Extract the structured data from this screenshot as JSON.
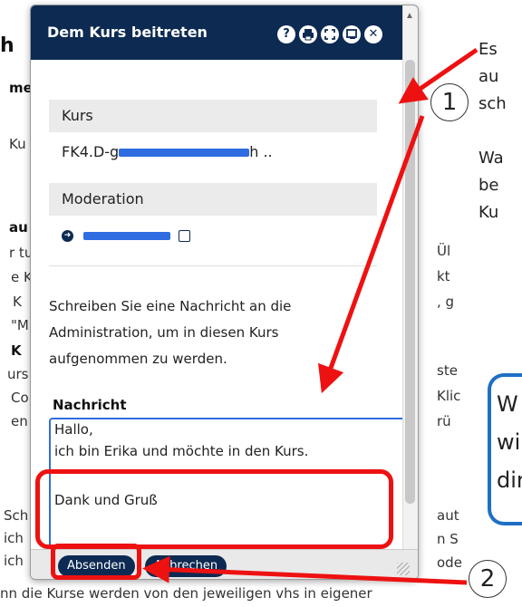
{
  "background": {
    "left_fragments": [
      "h",
      "me",
      "Ku",
      "au",
      "r tu",
      "e K",
      "K",
      "\"M",
      "K",
      "urs",
      "Co",
      "en",
      "Sch",
      "ich",
      "ich"
    ],
    "right_fragments": [
      "Ül",
      "kt",
      ", g",
      "ste",
      "Klic",
      "rü",
      "aut",
      "n S",
      "ode"
    ],
    "bottom_line": "nn die Kurse werden von den jeweiligen vhs in eigener"
  },
  "annotations": {
    "right_lines_1": [
      "Es",
      "au",
      "sch"
    ],
    "right_lines_2": [
      "Wa",
      "be",
      "Ku"
    ],
    "blue_box_lines": [
      "W",
      "wi",
      "dir"
    ],
    "step1": "1",
    "step2": "2"
  },
  "dialog": {
    "title": "Dem Kurs beitreten",
    "header_icons": [
      "help-icon",
      "print-icon",
      "fullscreen-icon",
      "minimize-icon",
      "close-icon"
    ],
    "fields": {
      "kurs_label": "Kurs",
      "kurs_value": "FK4.D-g",
      "kurs_value_suffix": "h ..",
      "moderation_label": "Moderation"
    },
    "instruction": "Schreiben Sie eine Nachricht an die Administration, um in diesen Kurs aufgenommen zu werden.",
    "message_label": "Nachricht",
    "message_lines": [
      "Hallo,",
      "ich bin Erika und möchte in den Kurs.",
      "",
      "Dank und Gruß"
    ],
    "buttons": {
      "send": "Absenden",
      "cancel": "Abbrechen"
    }
  },
  "colors": {
    "header": "#0d2a52",
    "accent_red": "#e11111",
    "accent_blue": "#1f6fc5",
    "redaction": "#2f6de0"
  }
}
